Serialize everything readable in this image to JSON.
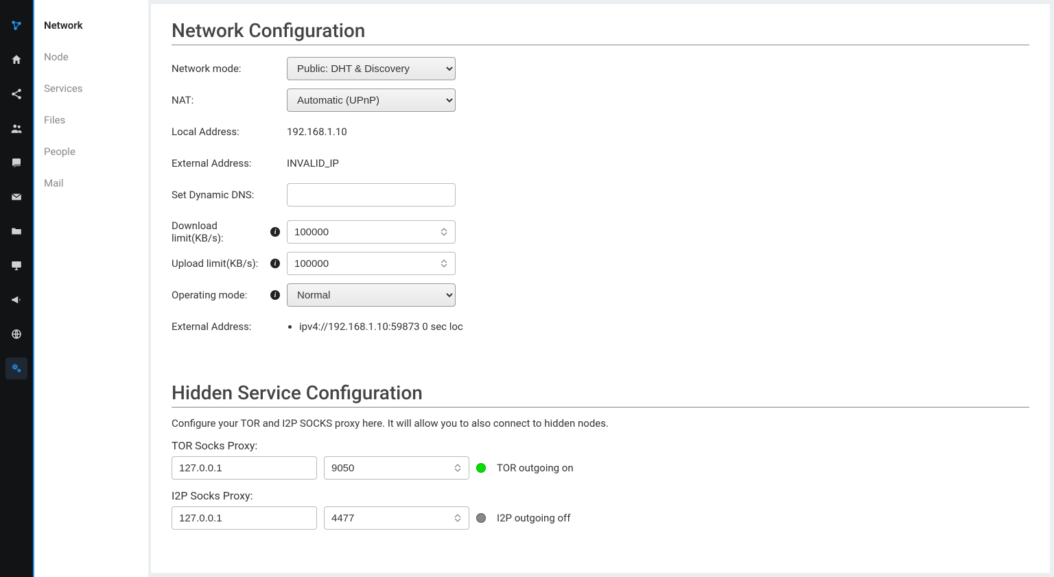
{
  "rail_icons": [
    {
      "name": "logo-icon"
    },
    {
      "name": "home-icon"
    },
    {
      "name": "share-icon"
    },
    {
      "name": "people-icon"
    },
    {
      "name": "chat-icon"
    },
    {
      "name": "mail-icon"
    },
    {
      "name": "folder-icon"
    },
    {
      "name": "monitor-icon"
    },
    {
      "name": "bullhorn-icon"
    },
    {
      "name": "globe-icon"
    },
    {
      "name": "settings-icon"
    }
  ],
  "sidebar": {
    "items": [
      {
        "label": "Network",
        "current": true
      },
      {
        "label": "Node"
      },
      {
        "label": "Services"
      },
      {
        "label": "Files"
      },
      {
        "label": "People"
      },
      {
        "label": "Mail"
      }
    ]
  },
  "network_config": {
    "title": "Network Configuration",
    "labels": {
      "network_mode": "Network mode:",
      "nat": "NAT:",
      "local_address": "Local Address:",
      "external_address": "External Address:",
      "dynamic_dns": "Set Dynamic DNS:",
      "download_limit": "Download limit(KB/s):",
      "upload_limit": "Upload limit(KB/s):",
      "operating_mode": "Operating mode:",
      "external_address_list": "External Address:"
    },
    "network_mode_value": "Public: DHT & Discovery",
    "nat_value": "Automatic (UPnP)",
    "local_address_value": "192.168.1.10",
    "external_address_value": "INVALID_IP",
    "dynamic_dns_value": "",
    "download_limit_value": "100000",
    "upload_limit_value": "100000",
    "operating_mode_value": "Normal",
    "external_address_item": "ipv4://192.168.1.10:59873 0 sec loc"
  },
  "hidden_service": {
    "title": "Hidden Service Configuration",
    "description": "Configure your TOR and I2P SOCKS proxy here. It will allow you to also connect to hidden nodes.",
    "tor": {
      "label": "TOR Socks Proxy:",
      "host": "127.0.0.1",
      "port": "9050",
      "status_text": "TOR outgoing on",
      "status": "on"
    },
    "i2p": {
      "label": "I2P Socks Proxy:",
      "host": "127.0.0.1",
      "port": "4477",
      "status_text": "I2P outgoing off",
      "status": "off"
    }
  }
}
